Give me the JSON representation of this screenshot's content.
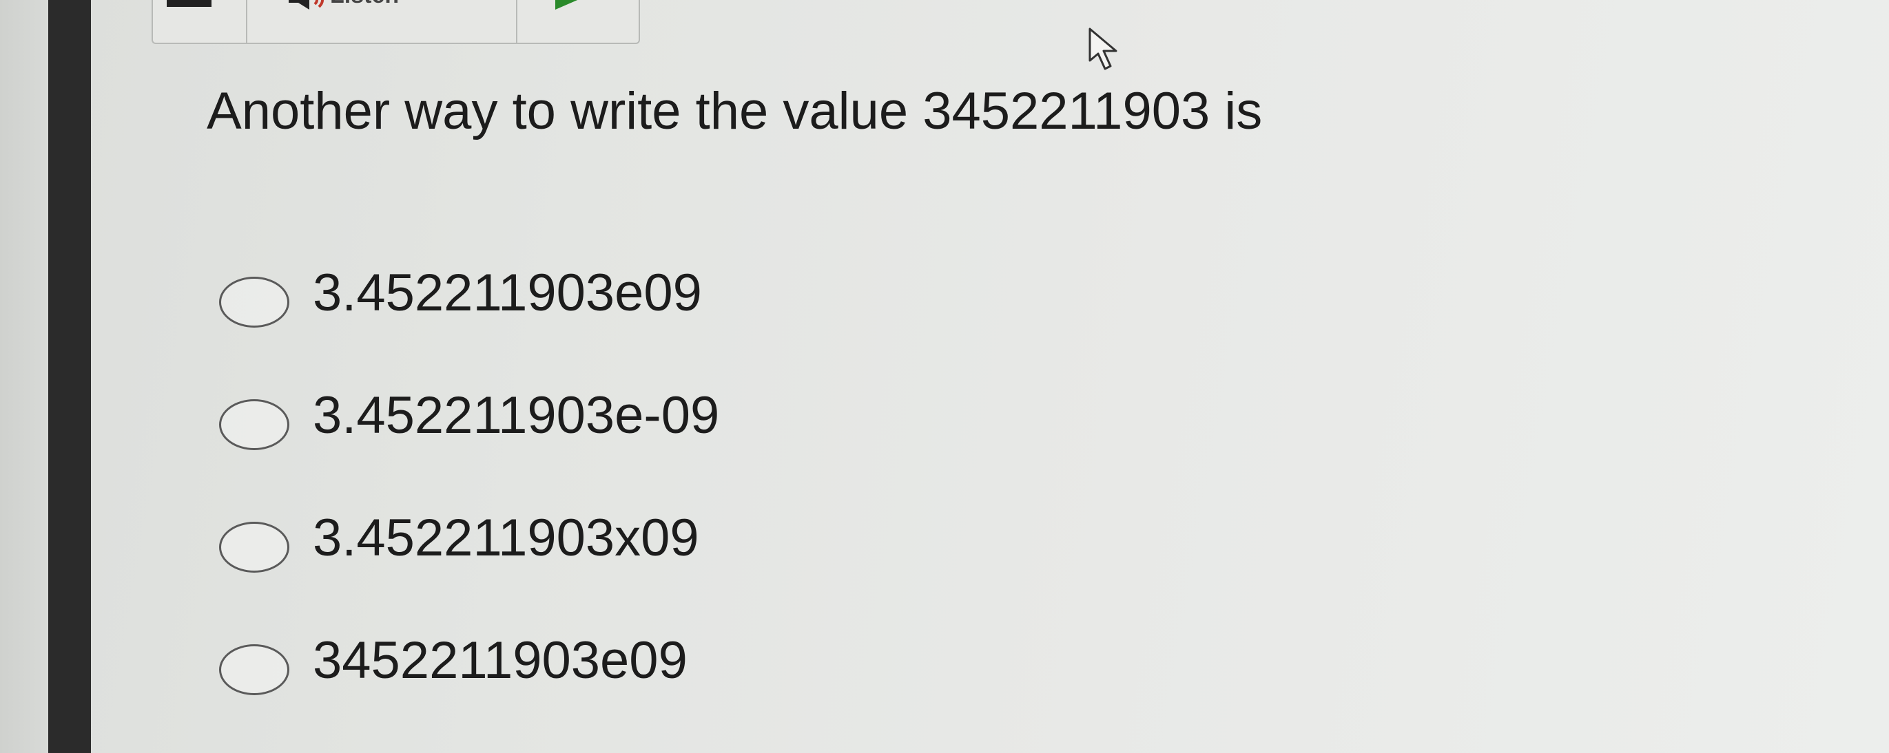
{
  "toolbar": {
    "menu_icon": "hamburger-menu-icon",
    "speaker_icon": "speaker-icon",
    "listen_label": "Listen",
    "play_icon": "play-icon",
    "play_color": "#2a8a2a"
  },
  "question": {
    "text": "Another way to write the value 3452211903 is"
  },
  "options": [
    {
      "label": "3.452211903e09",
      "selected": false
    },
    {
      "label": "3.452211903e-09",
      "selected": false
    },
    {
      "label": "3.452211903x09",
      "selected": false
    },
    {
      "label": "3452211903e09",
      "selected": false
    }
  ],
  "cursor_icon": "mouse-pointer-icon"
}
